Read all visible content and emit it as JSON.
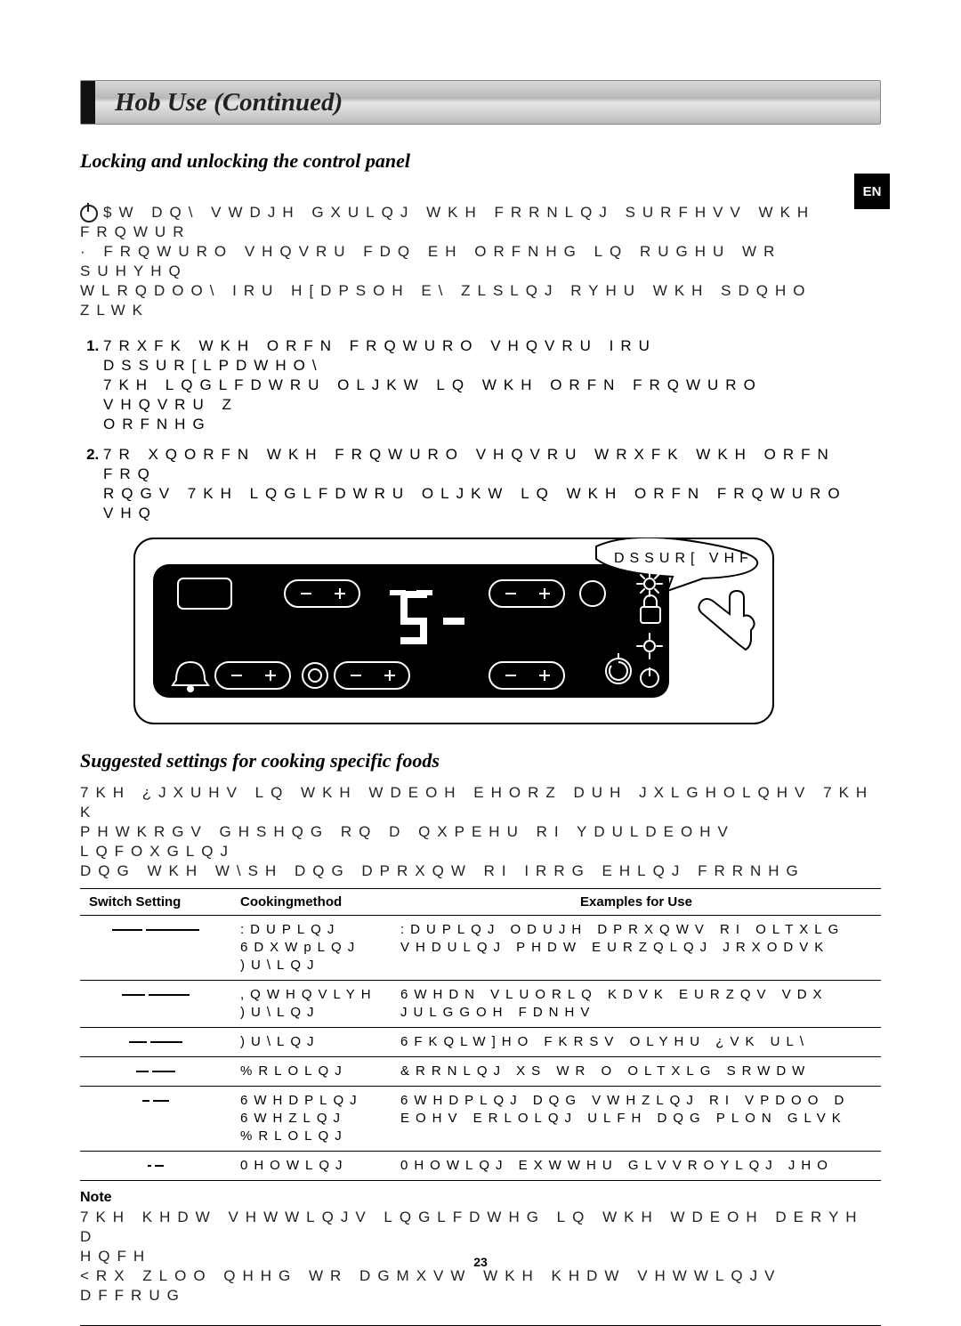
{
  "title": "Hob Use (Continued)",
  "lang_badge": "EN",
  "section1": {
    "heading": "Locking and unlocking the control panel",
    "para": "$W DQ\\ VWDJH GXULQJ WKH FRRNLQJ SURFHVV  WKH FRQWUR\n · FRQWURO VHQVRU  FDQ EH ORFNHG LQ RUGHU WR SUHYHQ\nWLRQDOO\\  IRU H[DPSOH  E\\ ZLSLQJ RYHU WKH SDQHO ZLWK",
    "steps": [
      "7RXFK WKH ORFN FRQWURO VHQVRU IRU DSSUR[LPDWHO\\\n7KH LQGLFDWRU OLJKW LQ WKH ORFN FRQWURO VHQVRU Z\nORFNHG",
      "7R XQORFN WKH FRQWURO VHQVRU  WRXFK WKH ORFN FRQ\nRQGV  7KH LQGLFDWRU OLJKW LQ WKH ORFN FRQWURO VHQ"
    ],
    "callout": "DSSUR[    VHF"
  },
  "section2": {
    "heading": "Suggested settings for cooking specific foods",
    "para": "7KH ¿JXUHV LQ WKH WDEOH EHORZ DUH JXLGHOLQHV  7KH K\nPHWKRGV GHSHQG RQ D QXPEHU RI YDULDEOHV  LQFOXGLQJ\nDQG WKH W\\SH DQG DPRXQW RI IRRG EHLQJ FRRNHG"
  },
  "table": {
    "headers": [
      "Switch Setting",
      "Cookingmethod",
      "Examples for Use"
    ],
    "rows": [
      {
        "level_bars": [
          34,
          60
        ],
        "method": ":DUPLQJ\n6DXWpLQJ\n)U\\LQJ",
        "example": ":DUPLQJ ODUJH DPRXQWV RI OLTXLG\nVHDULQJ PHDW  EURZQLQJ JRXODVK"
      },
      {
        "level_bars": [
          26,
          46
        ],
        "method": ",QWHQVLYH\n)U\\LQJ",
        "example": "6WHDN  VLUORLQ  KDVK EURZQV  VDX\nJULGGOH FDNHV"
      },
      {
        "level_bars": [
          20,
          36
        ],
        "method": ")U\\LQJ",
        "example": "6FKQLW]HO  FKRSV  OLYHU  ¿VK  UL\\"
      },
      {
        "level_bars": [
          14,
          26
        ],
        "method": "%RLOLQJ",
        "example": "&RRNLQJ XS WR   O OLTXLG  SRWDW"
      },
      {
        "level_bars": [
          8,
          18
        ],
        "method": "6WHDPLQJ\n6WHZLQJ\n%RLOLQJ",
        "example": "6WHDPLQJ DQG VWHZLQJ RI VPDOO D\nEOHV  ERLOLQJ ULFH DQG PLON GLVK"
      },
      {
        "level_bars": [
          4,
          10
        ],
        "method": "0HOWLQJ",
        "example": "0HOWLQJ EXWWHU  GLVVROYLQJ JHO"
      }
    ]
  },
  "note": {
    "heading": "Note",
    "body": "  7KH KHDW VHWWLQJV LQGLFDWHG LQ WKH WDEOH DERYH D\nHQFH\n  <RX ZLOO QHHG WR DGMXVW WKH KHDW VHWWLQJV DFFRUG"
  },
  "page_number": "23"
}
